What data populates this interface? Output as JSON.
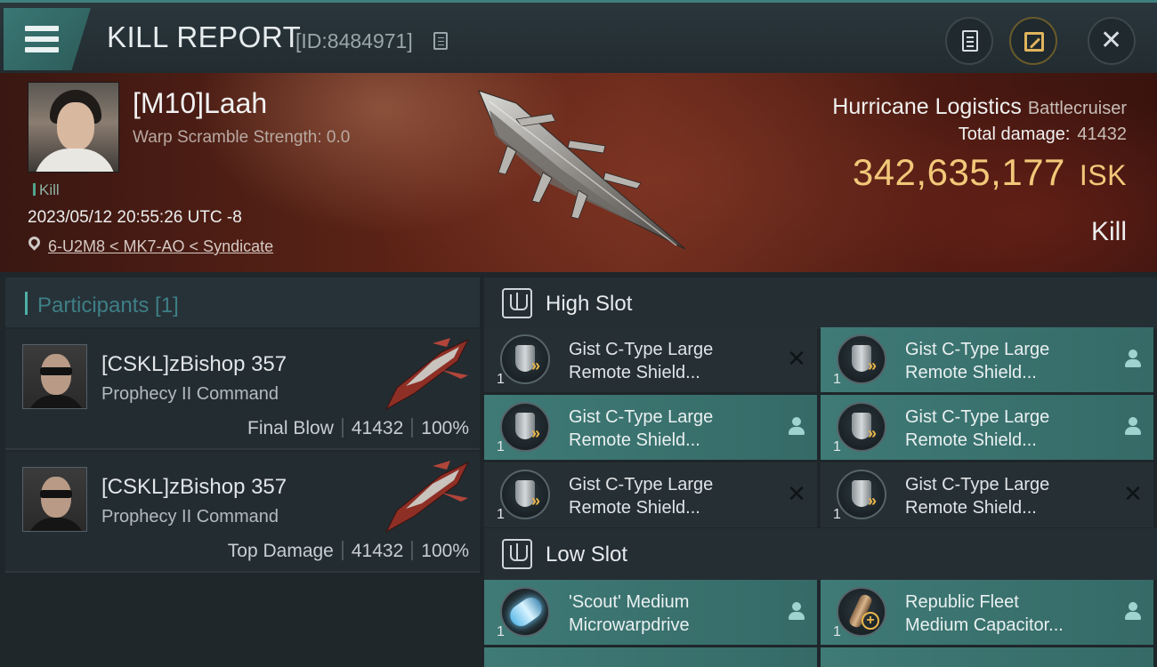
{
  "header": {
    "title": "KILL REPORT",
    "report_id": "[ID:8484971]"
  },
  "victim": {
    "name": "[M10]Laah",
    "warp_scramble": "Warp Scramble Strength: 0.0",
    "tag": "Kill",
    "timestamp": "2023/05/12 20:55:26 UTC -8",
    "location": "6-U2M8 < MK7-AO < Syndicate"
  },
  "ship": {
    "name": "Hurricane Logistics",
    "class": "Battlecruiser",
    "total_damage_label": "Total damage:",
    "total_damage_value": "41432",
    "isk_value": "342,635,177",
    "isk_unit": "ISK",
    "result": "Kill"
  },
  "participants": {
    "title": "Participants [1]",
    "items": [
      {
        "name": "[CSKL]zBishop 357",
        "ship": "Prophecy II Command",
        "role": "Final Blow",
        "damage": "41432",
        "percent": "100%"
      },
      {
        "name": "[CSKL]zBishop 357",
        "ship": "Prophecy II Command",
        "role": "Top Damage",
        "damage": "41432",
        "percent": "100%"
      }
    ]
  },
  "slots": {
    "high_title": "High Slot",
    "low_title": "Low Slot",
    "high": [
      {
        "line1": "Gist C-Type Large",
        "line2": "Remote Shield...",
        "qty": "1",
        "status": "destroyed",
        "icon": "shield-booster-icon"
      },
      {
        "line1": "Gist C-Type Large",
        "line2": "Remote Shield...",
        "qty": "1",
        "status": "dropped",
        "icon": "shield-booster-icon"
      },
      {
        "line1": "Gist C-Type Large",
        "line2": "Remote Shield...",
        "qty": "1",
        "status": "dropped",
        "icon": "shield-booster-icon"
      },
      {
        "line1": "Gist C-Type Large",
        "line2": "Remote Shield...",
        "qty": "1",
        "status": "dropped",
        "icon": "shield-booster-icon"
      },
      {
        "line1": "Gist C-Type Large",
        "line2": "Remote Shield...",
        "qty": "1",
        "status": "destroyed",
        "icon": "shield-booster-icon"
      },
      {
        "line1": "Gist C-Type Large",
        "line2": "Remote Shield...",
        "qty": "1",
        "status": "destroyed",
        "icon": "shield-booster-icon"
      }
    ],
    "low": [
      {
        "line1": "'Scout' Medium",
        "line2": "Microwarpdrive",
        "qty": "1",
        "status": "dropped",
        "icon": "microwarpdrive-icon"
      },
      {
        "line1": "Republic Fleet",
        "line2": "Medium Capacitor...",
        "qty": "1",
        "status": "dropped",
        "icon": "capacitor-booster-icon"
      }
    ]
  },
  "colors": {
    "accent": "#3f7a76",
    "isk": "#f2c879",
    "hero": "#5c2316"
  }
}
